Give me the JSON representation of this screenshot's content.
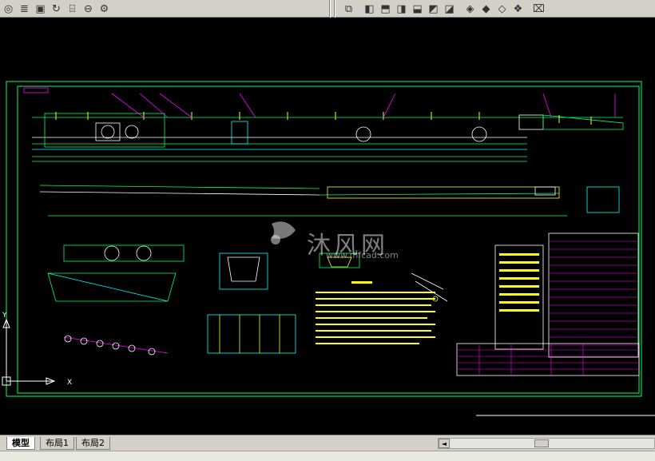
{
  "toolbar": {
    "left_icons": [
      "circle-dot-icon",
      "layers-icon",
      "cube-icon",
      "rotate-icon",
      "cylinder-icon",
      "intersect-icon",
      "gear-circle-icon"
    ],
    "right_icons": [
      "view-icon",
      "box-front-icon",
      "box-top-icon",
      "box-side-icon",
      "box-back-icon",
      "box-iso-icon",
      "box-right-icon",
      "diamond-1-icon",
      "diamond-2-icon",
      "diamond-3-icon",
      "diamond-4-icon",
      "camera-icon"
    ]
  },
  "tabs": [
    {
      "label": "模型",
      "active": true
    },
    {
      "label": "布局1",
      "active": false
    },
    {
      "label": "布局2",
      "active": false
    }
  ],
  "watermark": {
    "cn": "沐风网",
    "en": "www.mfcad.com"
  },
  "ucs": {
    "y_label": "Y",
    "x_label": "X"
  },
  "colors": {
    "background": "#000000",
    "frame": "#00ff66",
    "drawing": "#ffffff",
    "accent_magenta": "#ff00ff",
    "accent_cyan": "#00ffff",
    "accent_yellow": "#ffff00"
  }
}
